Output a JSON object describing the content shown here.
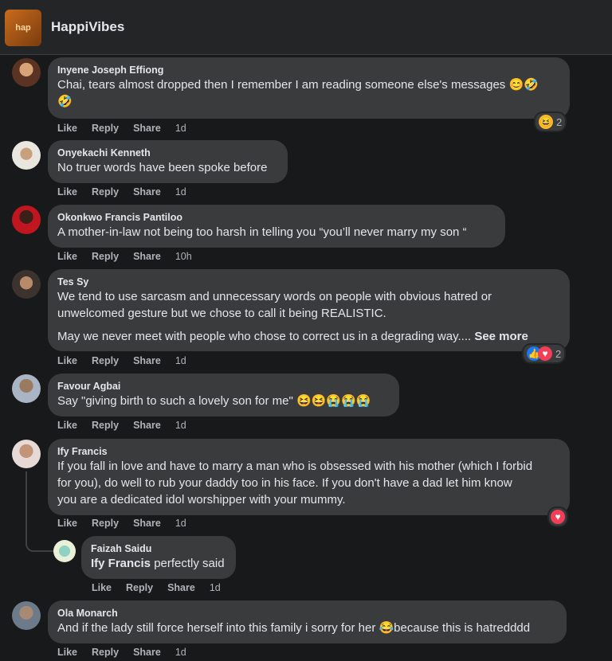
{
  "page": {
    "title": "HappiVibes",
    "avatar_text": "hap"
  },
  "actions": {
    "like": "Like",
    "reply": "Reply",
    "share": "Share"
  },
  "comments": [
    {
      "author": "Inyene Joseph Effiong",
      "lines": [
        "Chai, tears almost dropped then I remember I am reading someone else's messages 😊🤣",
        "🤣"
      ],
      "time": "1d",
      "reaction_count": "2",
      "reaction_icons": [
        "laughing-emoji"
      ]
    },
    {
      "author": "Onyekachi Kenneth",
      "lines": [
        "No truer words have been spoke before"
      ],
      "time": "1d"
    },
    {
      "author": "Okonkwo Francis Pantiloo",
      "lines": [
        "A mother-in-law not being too harsh in telling you “you’ll never marry my son “"
      ],
      "time": "10h"
    },
    {
      "author": "Tes Sy",
      "lines": [
        "We tend to use sarcasm and unnecessary words on people with obvious hatred or",
        "unwelcomed gesture but we chose to call it being REALISTIC.",
        "May we never meet with people who chose to correct us in a degrading way...."
      ],
      "see_more": "See more",
      "time": "1d",
      "reaction_count": "2",
      "reaction_icons": [
        "like-icon",
        "love-icon"
      ]
    },
    {
      "author": "Favour Agbai",
      "lines": [
        "Say \"giving birth to such a lovely son for me\" 😆😆😭😭😭"
      ],
      "time": "1d"
    },
    {
      "author": "Ify Francis",
      "lines": [
        "If you fall in love and have to marry a man who is obsessed with his mother (which I forbid",
        "for you), do well to rub your daddy too in his face. If you don't have a dad let him know",
        "you are a dedicated idol worshipper with your mummy."
      ],
      "time": "1d",
      "reaction_icons": [
        "love-icon"
      ]
    },
    {
      "author": "Faizah Saidu",
      "mention": "Ify Francis",
      "lines": [
        " perfectly said"
      ],
      "time": "1d"
    },
    {
      "author": "Ola Monarch",
      "lines": [
        "And if the lady still force herself into this family i sorry for her 😂because this is hatredddd"
      ],
      "time": "1d"
    }
  ],
  "colors": {
    "background": "#18191a",
    "bubble": "#3a3b3c",
    "text": "#e4e6eb",
    "muted": "#b0b3b8",
    "like_blue": "#1877f2",
    "love_red": "#f33e58"
  }
}
